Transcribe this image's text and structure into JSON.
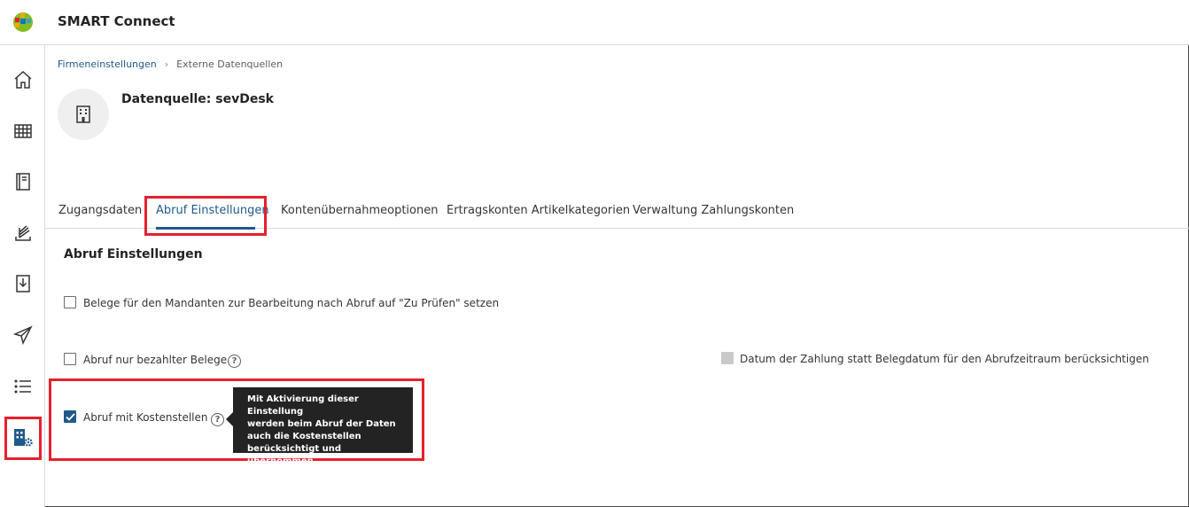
{
  "app": {
    "title": "SMART Connect"
  },
  "sidebar": {
    "items": [
      {
        "icon": "home-icon"
      },
      {
        "icon": "table-icon"
      },
      {
        "icon": "notebook-icon"
      },
      {
        "icon": "document-stack-icon"
      },
      {
        "icon": "download-icon"
      },
      {
        "icon": "send-icon"
      },
      {
        "icon": "list-icon"
      },
      {
        "icon": "company-settings-icon",
        "active": true
      }
    ]
  },
  "breadcrumb": {
    "parent": "Firmeneinstellungen",
    "current": "Externe Datenquellen"
  },
  "page": {
    "title": "Datenquelle: sevDesk"
  },
  "tabs": [
    {
      "label": "Zugangsdaten"
    },
    {
      "label": "Abruf Einstellungen",
      "active": true
    },
    {
      "label": "Kontenübernahmeoptionen"
    },
    {
      "label": "Ertragskonten Artikelkategorien"
    },
    {
      "label": "Verwaltung Zahlungskonten"
    }
  ],
  "section": {
    "title": "Abruf Einstellungen",
    "options": {
      "zu_pruefen": {
        "label": "Belege für den Mandanten zur Bearbeitung nach Abruf auf \"Zu Prüfen\" setzen",
        "checked": false
      },
      "nur_bezahlt": {
        "label": "Abruf nur bezahlter Belege",
        "checked": false
      },
      "zahlungsdatum": {
        "label": "Datum der Zahlung statt Belegdatum für den Abrufzeitraum berücksichtigen",
        "checked": false,
        "disabled": true
      },
      "kostenstellen": {
        "label": "Abruf mit Kostenstellen",
        "checked": true
      }
    },
    "tooltip": {
      "lines": [
        "Mit Aktivierung dieser Einstellung",
        "werden beim Abruf der Daten",
        "auch die Kostenstellen",
        "berücksichtigt und übernommen."
      ]
    }
  },
  "colors": {
    "accent": "#1f5a8a",
    "highlight": "#e5202e",
    "tooltip_bg": "#232323"
  }
}
